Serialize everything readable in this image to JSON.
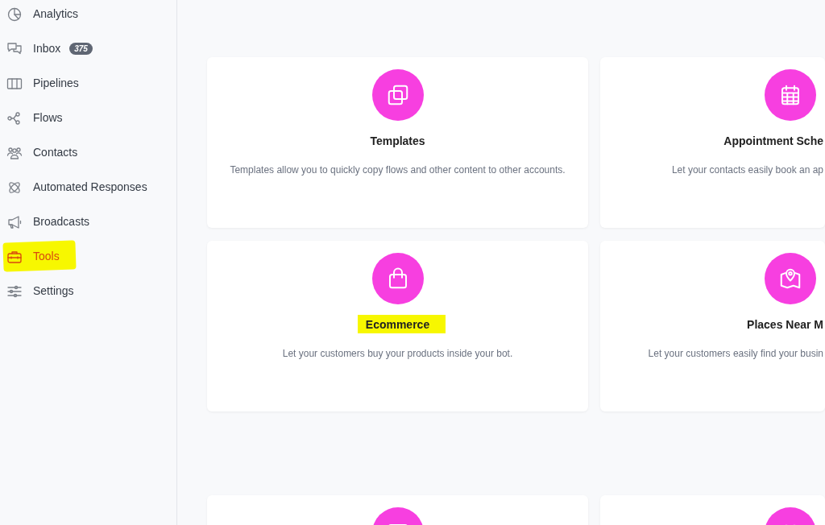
{
  "sidebar": {
    "items": [
      {
        "label": "Analytics",
        "selected": false,
        "highlighted": false
      },
      {
        "label": "Inbox",
        "badge": "375",
        "selected": false,
        "highlighted": false
      },
      {
        "label": "Pipelines",
        "selected": false,
        "highlighted": false
      },
      {
        "label": "Flows",
        "selected": false,
        "highlighted": false
      },
      {
        "label": "Contacts",
        "selected": false,
        "highlighted": false
      },
      {
        "label": "Automated Responses",
        "selected": false,
        "highlighted": false
      },
      {
        "label": "Broadcasts",
        "selected": false,
        "highlighted": false
      },
      {
        "label": "Tools",
        "selected": true,
        "highlighted": true
      },
      {
        "label": "Settings",
        "selected": false,
        "highlighted": false
      }
    ]
  },
  "card_groups": [
    {
      "cards": [
        {
          "kind": "full",
          "title": "Templates",
          "description": "Templates allow you to quickly copy flows and other content to other accounts.",
          "highlighted": false
        },
        {
          "kind": "full",
          "title": "Appointment Sche",
          "description": "Let your contacts easily book an ap",
          "highlighted": false
        },
        {
          "kind": "full",
          "title": "Ecommerce",
          "description": "Let your customers buy your products inside your bot.",
          "highlighted": true
        },
        {
          "kind": "full",
          "title": "Places Near M",
          "description": "Let your customers easily find your busin",
          "highlighted": false
        }
      ]
    },
    {
      "cards": [
        {
          "kind": "cut_off"
        },
        {
          "kind": "cut_off"
        }
      ]
    }
  ]
}
